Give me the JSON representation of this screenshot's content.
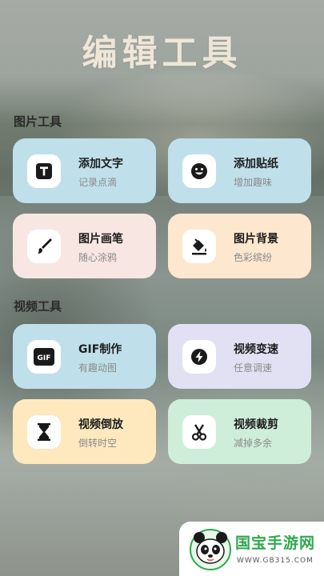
{
  "header": {
    "title": "编辑工具"
  },
  "sections": {
    "image": {
      "label": "图片工具"
    },
    "video": {
      "label": "视频工具"
    }
  },
  "cards": [
    {
      "title": "添加文字",
      "subtitle": "记录点滴",
      "icon": "text-icon",
      "color": "#bfe0ea"
    },
    {
      "title": "添加贴纸",
      "subtitle": "增加趣味",
      "icon": "smiley-icon",
      "color": "#bfe0ea"
    },
    {
      "title": "图片画笔",
      "subtitle": "随心涂鸦",
      "icon": "brush-icon",
      "color": "#f7e6e2"
    },
    {
      "title": "图片背景",
      "subtitle": "色彩缤纷",
      "icon": "paint-bucket-icon",
      "color": "#fde7cf"
    },
    {
      "title": "GIF制作",
      "subtitle": "有趣动图",
      "icon": "gif-icon",
      "color": "#bfe0ea"
    },
    {
      "title": "视频变速",
      "subtitle": "任意调速",
      "icon": "lightning-icon",
      "color": "#e1e1f3"
    },
    {
      "title": "视频倒放",
      "subtitle": "倒转时空",
      "icon": "hourglass-icon",
      "color": "#fde9bd"
    },
    {
      "title": "视频裁剪",
      "subtitle": "减掉多余",
      "icon": "scissors-icon",
      "color": "#cfeed9"
    }
  ],
  "watermark": {
    "brand": "国宝手游网",
    "url": "WWW.GB315.COM"
  }
}
